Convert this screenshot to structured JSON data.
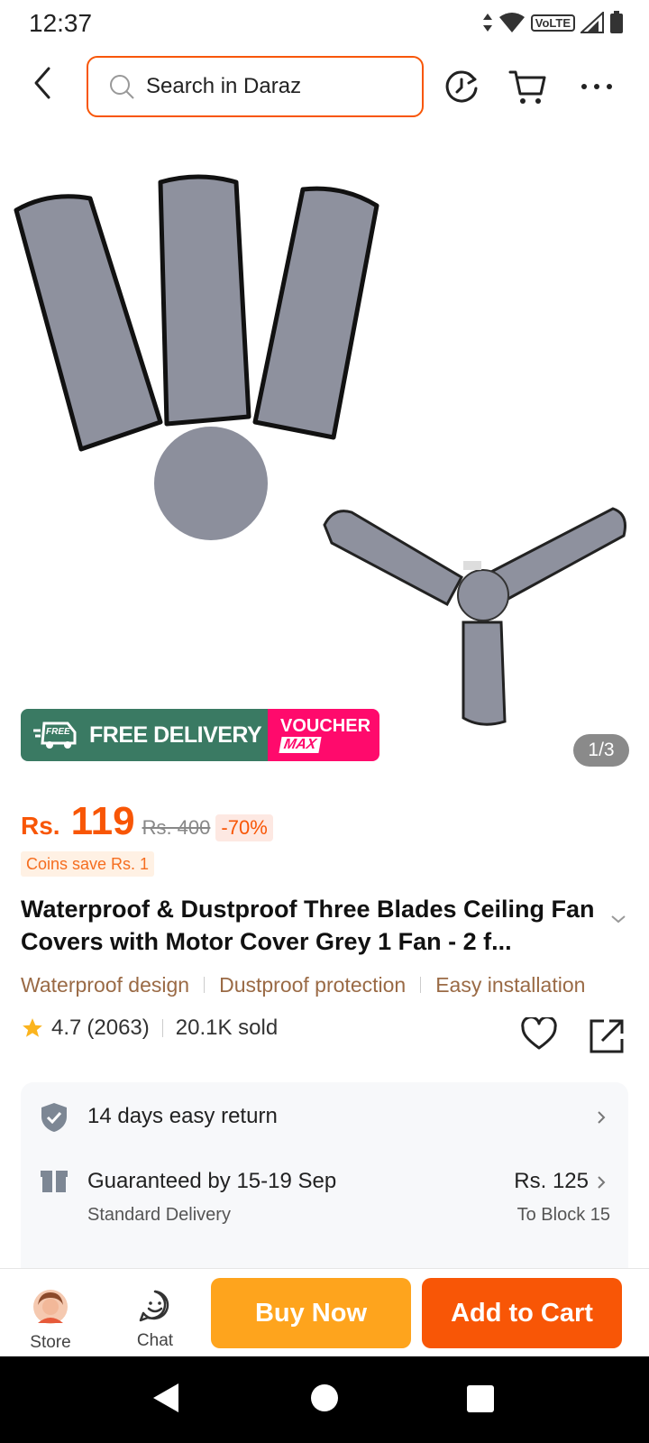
{
  "status_bar": {
    "time": "12:37",
    "network_label": "VoLTE"
  },
  "search": {
    "placeholder": "Search in Daraz"
  },
  "gallery": {
    "page_counter": "1/3"
  },
  "badges": {
    "free_delivery": "FREE DELIVERY",
    "free_tag": "FREE",
    "voucher_line1": "VOUCHER",
    "voucher_line2": "MAX"
  },
  "price": {
    "currency": "Rs.",
    "current": "119",
    "original": "Rs. 400",
    "discount": "-70%",
    "coins": "Coins save Rs. 1"
  },
  "product": {
    "title": "Waterproof & Dustproof Three Blades Ceiling Fan Covers with Motor Cover Grey 1 Fan - 2 f...",
    "features": [
      "Waterproof design",
      "Dustproof protection",
      "Easy installation"
    ],
    "rating": "4.7",
    "reviews": "(2063)",
    "sold": "20.1K sold"
  },
  "services": {
    "returns": "14 days easy return",
    "delivery_title": "Guaranteed by 15-19 Sep",
    "delivery_type": "Standard Delivery",
    "delivery_fee": "Rs. 125",
    "delivery_location": "To Block 15"
  },
  "action_bar": {
    "store_label": "Store",
    "chat_label": "Chat",
    "buy_now": "Buy Now",
    "add_to_cart": "Add to Cart"
  },
  "colors": {
    "accent": "#f85606",
    "buy_now": "#fea41d",
    "free_delivery": "#3a7a63",
    "voucher": "#ff0a6c"
  }
}
